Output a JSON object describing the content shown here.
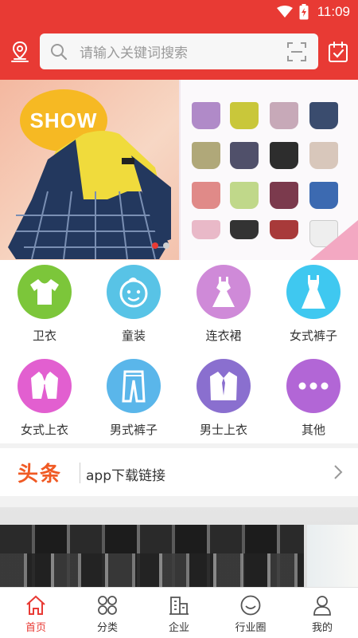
{
  "status_bar": {
    "time": "11:09"
  },
  "search": {
    "placeholder": "请输入关键词搜索"
  },
  "banner": {
    "left_badge": "SHOW",
    "active_dot_index": 0
  },
  "categories": [
    {
      "label": "卫衣",
      "icon": "tshirt-icon",
      "color": "#7cc63a"
    },
    {
      "label": "童装",
      "icon": "baby-face-icon",
      "color": "#58c3e6"
    },
    {
      "label": "连衣裙",
      "icon": "dress-icon",
      "color": "#cf8ad8"
    },
    {
      "label": "女式裤子",
      "icon": "gown-icon",
      "color": "#3fc8f0"
    },
    {
      "label": "女式上衣",
      "icon": "womens-jacket-icon",
      "color": "#e25fd0"
    },
    {
      "label": "男式裤子",
      "icon": "pants-icon",
      "color": "#5ab6ea"
    },
    {
      "label": "男士上衣",
      "icon": "mens-shirt-icon",
      "color": "#8a6fcf"
    },
    {
      "label": "其他",
      "icon": "more-icon",
      "color": "#b266d6"
    }
  ],
  "news": {
    "logo_text": "头条",
    "headline": "app下载链接"
  },
  "tabbar": [
    {
      "label": "首页",
      "icon": "home-icon",
      "active": true
    },
    {
      "label": "分类",
      "icon": "category-icon",
      "active": false
    },
    {
      "label": "企业",
      "icon": "enterprise-icon",
      "active": false
    },
    {
      "label": "行业圈",
      "icon": "circle-icon",
      "active": false
    },
    {
      "label": "我的",
      "icon": "profile-icon",
      "active": false
    }
  ],
  "colors": {
    "brand_red": "#e83a34",
    "news_orange": "#f05a24"
  }
}
